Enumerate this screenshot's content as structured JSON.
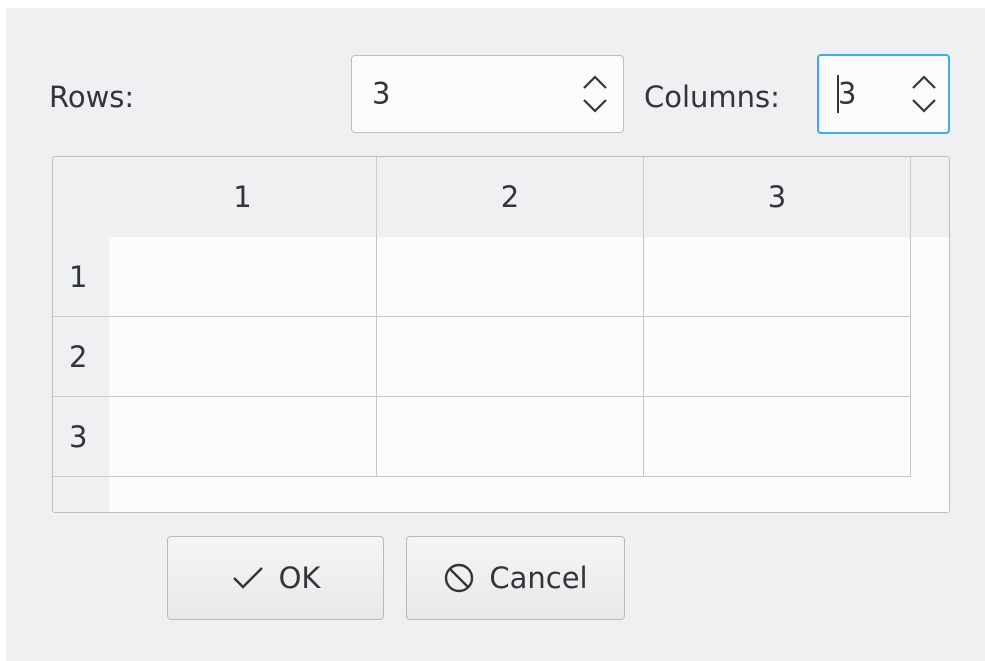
{
  "dialog": {
    "rows_label": "Rows:",
    "rows_value": "3",
    "columns_label": "Columns:",
    "columns_value": "3"
  },
  "table": {
    "column_headers": [
      "1",
      "2",
      "3"
    ],
    "row_headers": [
      "1",
      "2",
      "3"
    ],
    "cells": [
      [
        "",
        "",
        ""
      ],
      [
        "",
        "",
        ""
      ],
      [
        "",
        "",
        ""
      ]
    ]
  },
  "buttons": {
    "ok_label": "OK",
    "ok_icon": "checkmark-icon",
    "cancel_label": "Cancel",
    "cancel_icon": "cancel-circle-icon"
  },
  "colors": {
    "background": "#eff0f1",
    "focus_accent": "#3daee9",
    "text": "#31363b"
  }
}
